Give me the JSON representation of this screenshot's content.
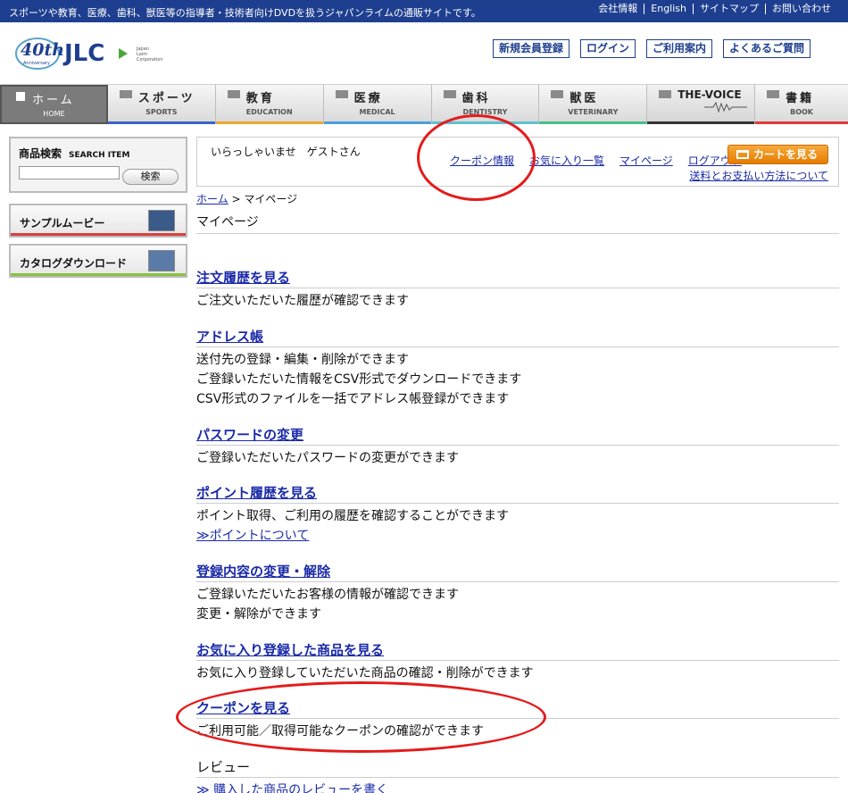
{
  "topbar": {
    "tagline": "スポーツや教育、医療、歯科、獣医等の指導者・技術者向けDVDを扱うジャパンライムの通販サイトです。",
    "links": [
      "会社情報",
      "English",
      "サイトマップ",
      "お問い合わせ"
    ]
  },
  "header": {
    "logo_text": "JLC",
    "anniversary": "40th",
    "anniversary_sub": "Anniversary",
    "company": "Japan Laim Corporation",
    "buttons": [
      "新規会員登録",
      "ログイン",
      "ご利用案内",
      "よくあるご質問"
    ]
  },
  "nav": [
    {
      "jp": "ホーム",
      "en": "HOME",
      "color": "#7b7b7b"
    },
    {
      "jp": "スポーツ",
      "en": "SPORTS",
      "color": "#3a64c8"
    },
    {
      "jp": "教育",
      "en": "EDUCATION",
      "color": "#f0a830"
    },
    {
      "jp": "医療",
      "en": "MEDICAL",
      "color": "#4aa0e0"
    },
    {
      "jp": "歯科",
      "en": "DENTISTRY",
      "color": "#5ec0d0"
    },
    {
      "jp": "獣医",
      "en": "VETERINARY",
      "color": "#44c08a"
    },
    {
      "jp": "THE-VOICE",
      "en": "",
      "color": "#333333"
    },
    {
      "jp": "書籍",
      "en": "BOOK",
      "color": "#e03a3a"
    }
  ],
  "sidebar": {
    "search_title": "商品検索",
    "search_title_en": "SEARCH ITEM",
    "search_placeholder": "",
    "search_button": "検索",
    "sample_movie": "サンプルムービー",
    "catalog_download": "カタログダウンロード"
  },
  "welcome": {
    "greeting": "いらっしゃいませ　ゲストさん",
    "links": [
      "クーポン情報",
      "お気に入り一覧",
      "マイページ",
      "ログアウト"
    ],
    "cart_button": "カートを見る",
    "shipping_link": "送料とお支払い方法について"
  },
  "breadcrumb": {
    "home": "ホーム",
    "sep": ">",
    "current": "マイページ"
  },
  "page_title": "マイページ",
  "sections": [
    {
      "title": "注文履歴を見る",
      "lines": [
        "ご注文いただいた履歴が確認できます"
      ]
    },
    {
      "title": "アドレス帳",
      "lines": [
        "送付先の登録・編集・削除ができます",
        "ご登録いただいた情報をCSV形式でダウンロードできます",
        "CSV形式のファイルを一括でアドレス帳登録ができます"
      ]
    },
    {
      "title": "パスワードの変更",
      "lines": [
        "ご登録いただいたパスワードの変更ができます"
      ]
    },
    {
      "title": "ポイント履歴を見る",
      "lines": [
        "ポイント取得、ご利用の履歴を確認することができます"
      ],
      "link": "≫ポイントについて"
    },
    {
      "title": "登録内容の変更・解除",
      "lines": [
        "ご登録いただいたお客様の情報が確認できます",
        "変更・解除ができます"
      ]
    },
    {
      "title": "お気に入り登録した商品を見る",
      "lines": [
        "お気に入り登録していただいた商品の確認・削除ができます"
      ]
    },
    {
      "title": "クーポンを見る",
      "lines": [
        "ご利用可能／取得可能なクーポンの確認ができます"
      ]
    },
    {
      "title": "レビュー",
      "link": "≫ 購入した商品のレビューを書く"
    }
  ]
}
